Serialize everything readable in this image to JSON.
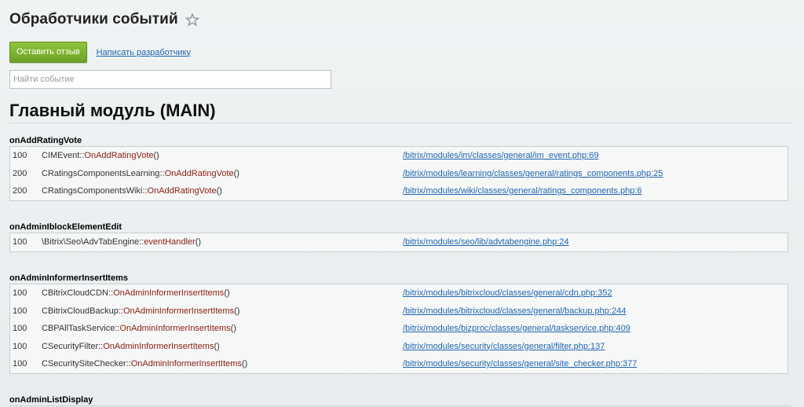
{
  "header": {
    "title": "Обработчики событий",
    "feedback_button": "Оставить отзыв",
    "developer_link": "Написать разработчику"
  },
  "search": {
    "placeholder": "Найти событие",
    "value": ""
  },
  "module": {
    "title": "Главный модуль (MAIN)"
  },
  "events": [
    {
      "name": "onAddRatingVote",
      "handlers": [
        {
          "sort": "100",
          "class": "CIMEvent",
          "sep": "::",
          "method": "OnAddRatingVote",
          "paren": "()",
          "path": "/bitrix/modules/im/classes/general/im_event.php:69"
        },
        {
          "sort": "200",
          "class": "CRatingsComponentsLearning",
          "sep": "::",
          "method": "OnAddRatingVote",
          "paren": "()",
          "path": "/bitrix/modules/learning/classes/general/ratings_components.php:25"
        },
        {
          "sort": "200",
          "class": "CRatingsComponentsWiki",
          "sep": "::",
          "method": "OnAddRatingVote",
          "paren": "()",
          "path": "/bitrix/modules/wiki/classes/general/ratings_components.php:6"
        }
      ]
    },
    {
      "name": "onAdminIblockElementEdit",
      "handlers": [
        {
          "sort": "100",
          "class": "\\Bitrix\\Seo\\AdvTabEngine",
          "sep": "::",
          "method": "eventHandler",
          "paren": "()",
          "path": "/bitrix/modules/seo/lib/advtabengine.php:24"
        }
      ]
    },
    {
      "name": "onAdminInformerInsertItems",
      "handlers": [
        {
          "sort": "100",
          "class": "CBitrixCloudCDN",
          "sep": "::",
          "method": "OnAdminInformerInsertItems",
          "paren": "()",
          "path": "/bitrix/modules/bitrixcloud/classes/general/cdn.php:352"
        },
        {
          "sort": "100",
          "class": "CBitrixCloudBackup",
          "sep": "::",
          "method": "OnAdminInformerInsertItems",
          "paren": "()",
          "path": "/bitrix/modules/bitrixcloud/classes/general/backup.php:244"
        },
        {
          "sort": "100",
          "class": "CBPAllTaskService",
          "sep": "::",
          "method": "OnAdminInformerInsertItems",
          "paren": "()",
          "path": "/bitrix/modules/bizproc/classes/general/taskservice.php:409"
        },
        {
          "sort": "100",
          "class": "CSecurityFilter",
          "sep": "::",
          "method": "OnAdminInformerInsertItems",
          "paren": "()",
          "path": "/bitrix/modules/security/classes/general/filter.php:137"
        },
        {
          "sort": "100",
          "class": "CSecuritySiteChecker",
          "sep": "::",
          "method": "OnAdminInformerInsertItems",
          "paren": "()",
          "path": "/bitrix/modules/security/classes/general/site_checker.php:377"
        }
      ]
    },
    {
      "name": "onAdminListDisplay",
      "handlers": []
    }
  ],
  "colors": {
    "accent_green": "#7ab32e",
    "link": "#2067b0",
    "method": "#8a1c11"
  }
}
